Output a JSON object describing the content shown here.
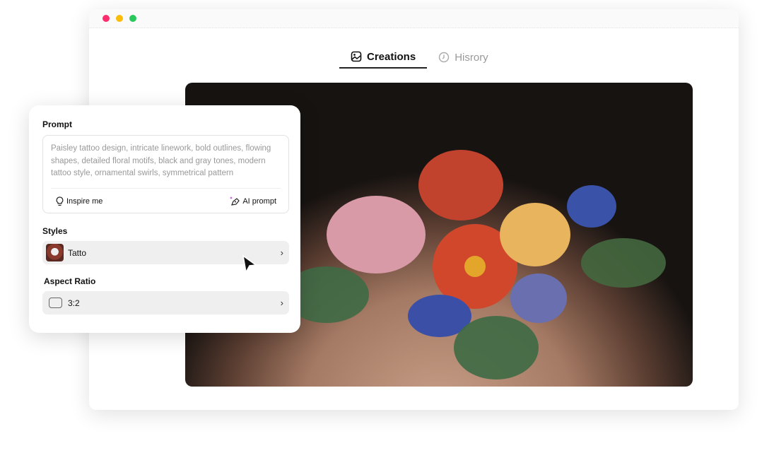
{
  "window": {
    "traffic_lights": {
      "close": "#ff2d6f",
      "minimize": "#fbbd09",
      "maximize": "#2ac85a"
    }
  },
  "tabs": [
    {
      "label": "Creations",
      "icon": "image-icon",
      "active": true
    },
    {
      "label": "Hisrory",
      "icon": "clock-icon",
      "active": false
    }
  ],
  "panel": {
    "prompt_label": "Prompt",
    "prompt_text": "Paisley tattoo design, intricate linework, bold outlines, flowing shapes, detailed floral motifs, black and gray tones, modern tattoo style, ornamental swirls, symmetrical pattern",
    "inspire_label": "Inspire me",
    "ai_prompt_label": "AI prompt",
    "styles_label": "Styles",
    "style_value": "Tatto",
    "aspect_label": "Aspect Ratio",
    "aspect_value": "3:2"
  },
  "accent": "#c040e0"
}
